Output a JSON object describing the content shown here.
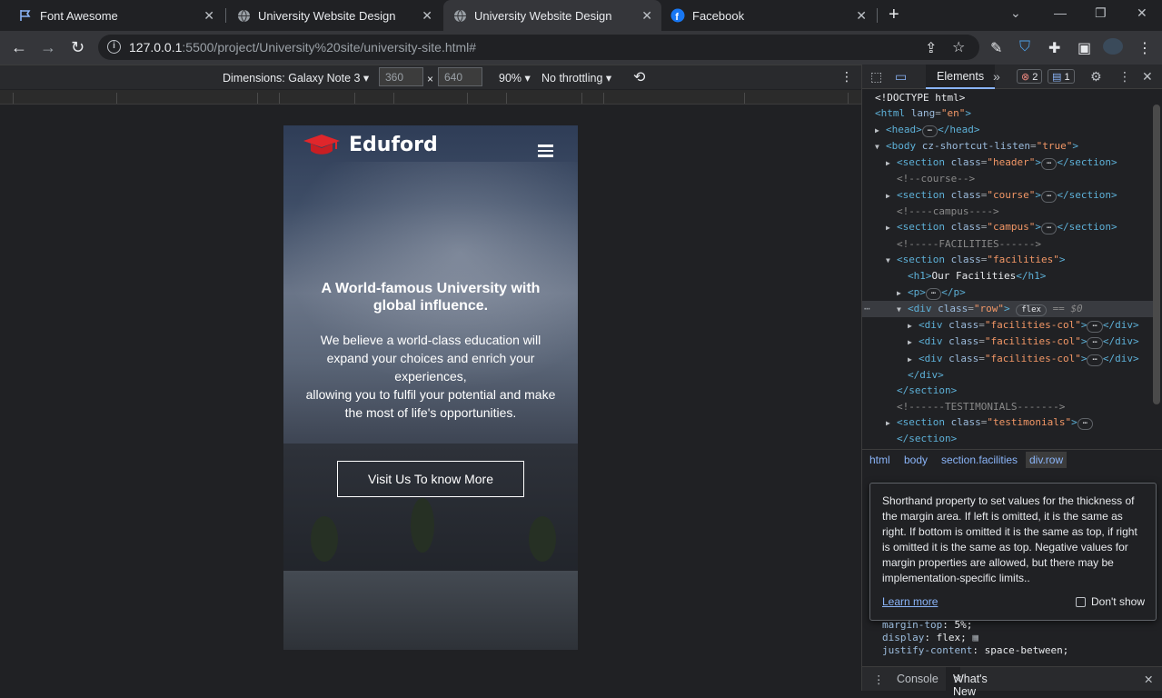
{
  "tabs": [
    {
      "title": "Font Awesome",
      "icon": "flag-icon"
    },
    {
      "title": "University Website Design",
      "icon": "globe-icon"
    },
    {
      "title": "University Website Design",
      "icon": "globe-icon"
    },
    {
      "title": "Facebook",
      "icon": "facebook-icon"
    }
  ],
  "address": {
    "host": "127.0.0.1",
    "path": ":5500/project/University%20site/university-site.html#"
  },
  "device_toolbar": {
    "dimensions_label": "Dimensions: Galaxy Note 3 ▾",
    "width": "360",
    "height": "640",
    "times": "×",
    "zoom": "90% ▾",
    "throttling": "No throttling ▾"
  },
  "site": {
    "brand": "Eduford",
    "hero_title": "A World-famous University with global influence.",
    "hero_text_1": "We believe a world-class education will expand your choices and enrich your experiences,",
    "hero_text_2": "allowing you to fulfil your potential and make the most of life's opportunities.",
    "cta": "Visit Us To know More"
  },
  "devtools": {
    "tab_elements": "Elements",
    "errors": "2",
    "messages": "1",
    "breadcrumbs": [
      "html",
      "body",
      "section.facilities",
      "div.row"
    ],
    "tooltip_text": "Shorthand property to set values for the thickness of the margin area. If left is omitted, it is the same as right. If bottom is omitted it is the same as top, if right is omitted it is the same as top. Negative values for margin properties are allowed, but there may be implementation-specific limits..",
    "learn_more": "Learn more",
    "dont_show": "Don't show",
    "style_lines": [
      {
        "prop": "margin-top",
        "val": "5%;"
      },
      {
        "prop": "display",
        "val": "flex;"
      },
      {
        "prop": "justify-content",
        "val": "space-between;"
      }
    ],
    "bottom_console": "Console",
    "bottom_whatsnew": "What's New"
  },
  "colors": {
    "accent": "#8ab4f8",
    "brand_red": "#e0262b",
    "selection": "#393b40"
  }
}
